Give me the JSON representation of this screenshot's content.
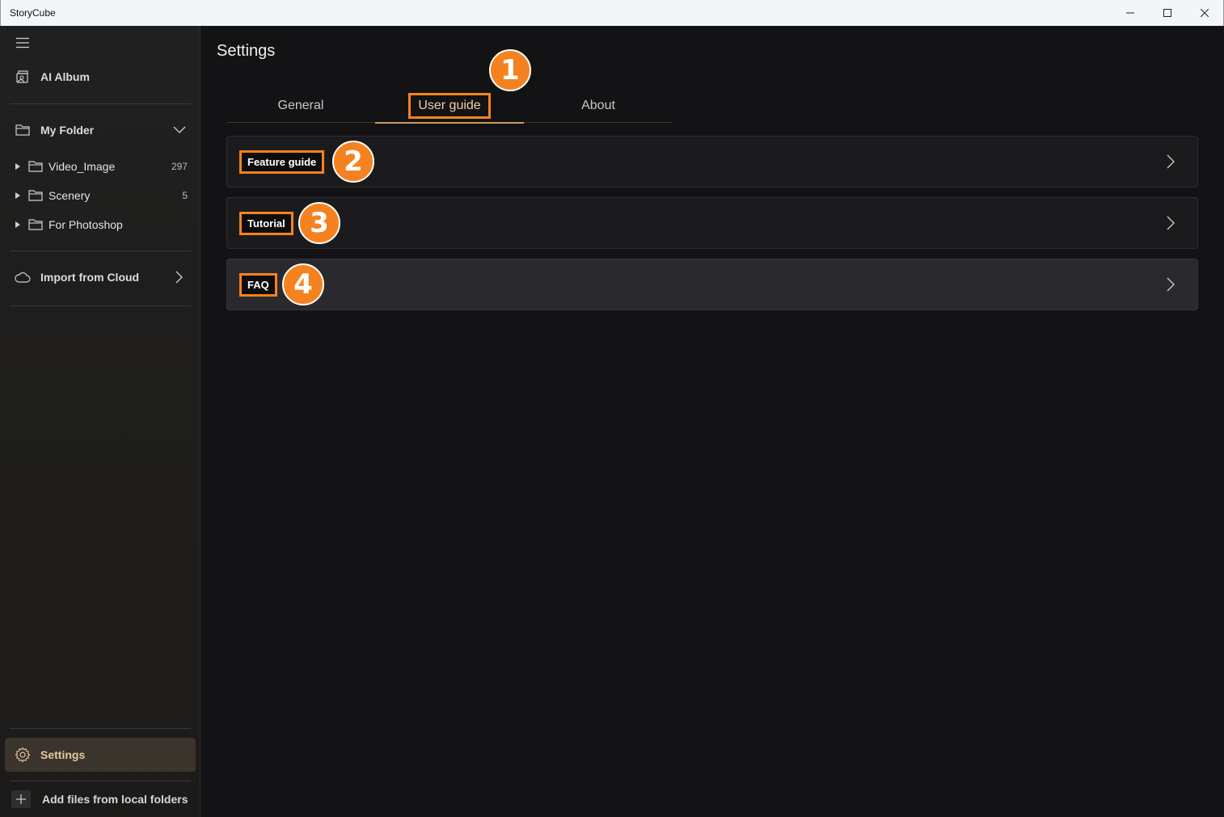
{
  "window": {
    "title": "StoryCube",
    "minimize_glyph": "—",
    "maximize_glyph": "☐",
    "close_glyph": "✕"
  },
  "sidebar": {
    "ai_album": "AI Album",
    "my_folder": "My Folder",
    "folders": [
      {
        "name": "Video_Image",
        "count": "297"
      },
      {
        "name": "Scenery",
        "count": "5"
      },
      {
        "name": "For Photoshop",
        "count": ""
      }
    ],
    "import_cloud": "Import from Cloud",
    "settings": "Settings",
    "add_files": "Add files from local folders"
  },
  "main": {
    "title": "Settings",
    "tabs": [
      {
        "label": "General",
        "active": false
      },
      {
        "label": "User guide",
        "active": true
      },
      {
        "label": "About",
        "active": false
      }
    ],
    "items": [
      {
        "label": "Feature guide",
        "badge": "2"
      },
      {
        "label": "Tutorial",
        "badge": "3"
      },
      {
        "label": "FAQ",
        "badge": "4"
      }
    ],
    "tab_badge": "1"
  },
  "colors": {
    "accent_orange": "#f58220",
    "settings_active_bg": "#3a342d",
    "settings_active_text": "#e6c9a0",
    "background": "#131315"
  },
  "icons": [
    "menu-icon",
    "ai-album-icon",
    "folder-icon",
    "chevron-down-icon",
    "caret-right-icon",
    "cloud-icon",
    "chevron-right-icon",
    "gear-icon",
    "plus-icon"
  ]
}
